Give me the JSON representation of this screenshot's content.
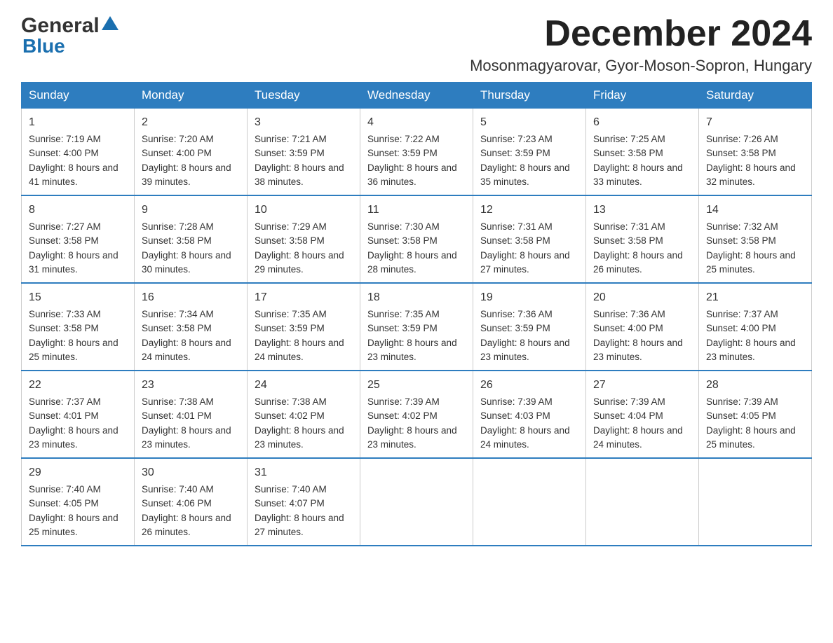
{
  "logo": {
    "general": "General",
    "blue": "Blue"
  },
  "header": {
    "month_year": "December 2024",
    "location": "Mosonmagyarovar, Gyor-Moson-Sopron, Hungary"
  },
  "weekdays": [
    "Sunday",
    "Monday",
    "Tuesday",
    "Wednesday",
    "Thursday",
    "Friday",
    "Saturday"
  ],
  "weeks": [
    [
      {
        "day": "1",
        "sunrise": "7:19 AM",
        "sunset": "4:00 PM",
        "daylight": "8 hours and 41 minutes."
      },
      {
        "day": "2",
        "sunrise": "7:20 AM",
        "sunset": "4:00 PM",
        "daylight": "8 hours and 39 minutes."
      },
      {
        "day": "3",
        "sunrise": "7:21 AM",
        "sunset": "3:59 PM",
        "daylight": "8 hours and 38 minutes."
      },
      {
        "day": "4",
        "sunrise": "7:22 AM",
        "sunset": "3:59 PM",
        "daylight": "8 hours and 36 minutes."
      },
      {
        "day": "5",
        "sunrise": "7:23 AM",
        "sunset": "3:59 PM",
        "daylight": "8 hours and 35 minutes."
      },
      {
        "day": "6",
        "sunrise": "7:25 AM",
        "sunset": "3:58 PM",
        "daylight": "8 hours and 33 minutes."
      },
      {
        "day": "7",
        "sunrise": "7:26 AM",
        "sunset": "3:58 PM",
        "daylight": "8 hours and 32 minutes."
      }
    ],
    [
      {
        "day": "8",
        "sunrise": "7:27 AM",
        "sunset": "3:58 PM",
        "daylight": "8 hours and 31 minutes."
      },
      {
        "day": "9",
        "sunrise": "7:28 AM",
        "sunset": "3:58 PM",
        "daylight": "8 hours and 30 minutes."
      },
      {
        "day": "10",
        "sunrise": "7:29 AM",
        "sunset": "3:58 PM",
        "daylight": "8 hours and 29 minutes."
      },
      {
        "day": "11",
        "sunrise": "7:30 AM",
        "sunset": "3:58 PM",
        "daylight": "8 hours and 28 minutes."
      },
      {
        "day": "12",
        "sunrise": "7:31 AM",
        "sunset": "3:58 PM",
        "daylight": "8 hours and 27 minutes."
      },
      {
        "day": "13",
        "sunrise": "7:31 AM",
        "sunset": "3:58 PM",
        "daylight": "8 hours and 26 minutes."
      },
      {
        "day": "14",
        "sunrise": "7:32 AM",
        "sunset": "3:58 PM",
        "daylight": "8 hours and 25 minutes."
      }
    ],
    [
      {
        "day": "15",
        "sunrise": "7:33 AM",
        "sunset": "3:58 PM",
        "daylight": "8 hours and 25 minutes."
      },
      {
        "day": "16",
        "sunrise": "7:34 AM",
        "sunset": "3:58 PM",
        "daylight": "8 hours and 24 minutes."
      },
      {
        "day": "17",
        "sunrise": "7:35 AM",
        "sunset": "3:59 PM",
        "daylight": "8 hours and 24 minutes."
      },
      {
        "day": "18",
        "sunrise": "7:35 AM",
        "sunset": "3:59 PM",
        "daylight": "8 hours and 23 minutes."
      },
      {
        "day": "19",
        "sunrise": "7:36 AM",
        "sunset": "3:59 PM",
        "daylight": "8 hours and 23 minutes."
      },
      {
        "day": "20",
        "sunrise": "7:36 AM",
        "sunset": "4:00 PM",
        "daylight": "8 hours and 23 minutes."
      },
      {
        "day": "21",
        "sunrise": "7:37 AM",
        "sunset": "4:00 PM",
        "daylight": "8 hours and 23 minutes."
      }
    ],
    [
      {
        "day": "22",
        "sunrise": "7:37 AM",
        "sunset": "4:01 PM",
        "daylight": "8 hours and 23 minutes."
      },
      {
        "day": "23",
        "sunrise": "7:38 AM",
        "sunset": "4:01 PM",
        "daylight": "8 hours and 23 minutes."
      },
      {
        "day": "24",
        "sunrise": "7:38 AM",
        "sunset": "4:02 PM",
        "daylight": "8 hours and 23 minutes."
      },
      {
        "day": "25",
        "sunrise": "7:39 AM",
        "sunset": "4:02 PM",
        "daylight": "8 hours and 23 minutes."
      },
      {
        "day": "26",
        "sunrise": "7:39 AM",
        "sunset": "4:03 PM",
        "daylight": "8 hours and 24 minutes."
      },
      {
        "day": "27",
        "sunrise": "7:39 AM",
        "sunset": "4:04 PM",
        "daylight": "8 hours and 24 minutes."
      },
      {
        "day": "28",
        "sunrise": "7:39 AM",
        "sunset": "4:05 PM",
        "daylight": "8 hours and 25 minutes."
      }
    ],
    [
      {
        "day": "29",
        "sunrise": "7:40 AM",
        "sunset": "4:05 PM",
        "daylight": "8 hours and 25 minutes."
      },
      {
        "day": "30",
        "sunrise": "7:40 AM",
        "sunset": "4:06 PM",
        "daylight": "8 hours and 26 minutes."
      },
      {
        "day": "31",
        "sunrise": "7:40 AM",
        "sunset": "4:07 PM",
        "daylight": "8 hours and 27 minutes."
      },
      null,
      null,
      null,
      null
    ]
  ],
  "labels": {
    "sunrise": "Sunrise:",
    "sunset": "Sunset:",
    "daylight": "Daylight:"
  }
}
